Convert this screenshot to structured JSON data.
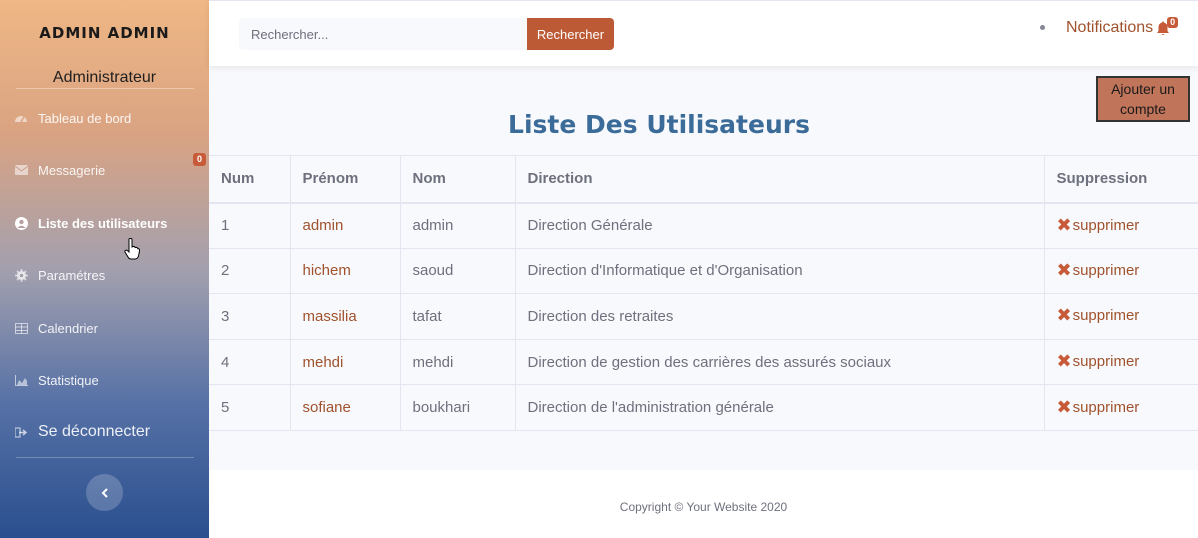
{
  "sidebar": {
    "brand": "ADMIN ADMIN",
    "role": "Administrateur",
    "items": [
      {
        "label": "Tableau de bord",
        "icon": "dashboard-icon"
      },
      {
        "label": "Messagerie",
        "icon": "envelope-icon",
        "badge": "0"
      },
      {
        "label": "Liste des utilisateurs",
        "icon": "user-circle-icon",
        "active": true
      },
      {
        "label": "Paramétres",
        "icon": "gear-icon"
      },
      {
        "label": "Calendrier",
        "icon": "table-icon"
      },
      {
        "label": "Statistique",
        "icon": "chart-area-icon"
      },
      {
        "label": "Se déconnecter",
        "icon": "sign-out-icon"
      }
    ],
    "toggle_icon": "chevron-left-icon"
  },
  "topbar": {
    "search_placeholder": "Rechercher...",
    "search_button": "Rechercher",
    "notifications_label": "Notifications",
    "notifications_count": "0"
  },
  "main": {
    "add_button": "Ajouter un compte",
    "title": "Liste Des Utilisateurs",
    "table": {
      "headers": [
        "Num",
        "Prénom",
        "Nom",
        "Direction",
        "Suppression"
      ],
      "rows": [
        {
          "num": "1",
          "prenom": "admin",
          "nom": "admin",
          "direction": "Direction Générale",
          "action": "supprimer"
        },
        {
          "num": "2",
          "prenom": "hichem",
          "nom": "saoud",
          "direction": "Direction d'Informatique et d'Organisation",
          "action": "supprimer"
        },
        {
          "num": "3",
          "prenom": "massilia",
          "nom": "tafat",
          "direction": "Direction des retraites",
          "action": "supprimer"
        },
        {
          "num": "4",
          "prenom": "mehdi",
          "nom": "mehdi",
          "direction": "Direction de gestion des carrières des assurés sociaux",
          "action": "supprimer"
        },
        {
          "num": "5",
          "prenom": "sofiane",
          "nom": "boukhari",
          "direction": "Direction de l'administration générale",
          "action": "supprimer"
        }
      ]
    }
  },
  "footer": {
    "copyright": "Copyright © Your Website 2020"
  },
  "colors": {
    "accent": "#bd5a36",
    "title_blue": "#3a6b99",
    "link_brown": "#a0522d"
  }
}
